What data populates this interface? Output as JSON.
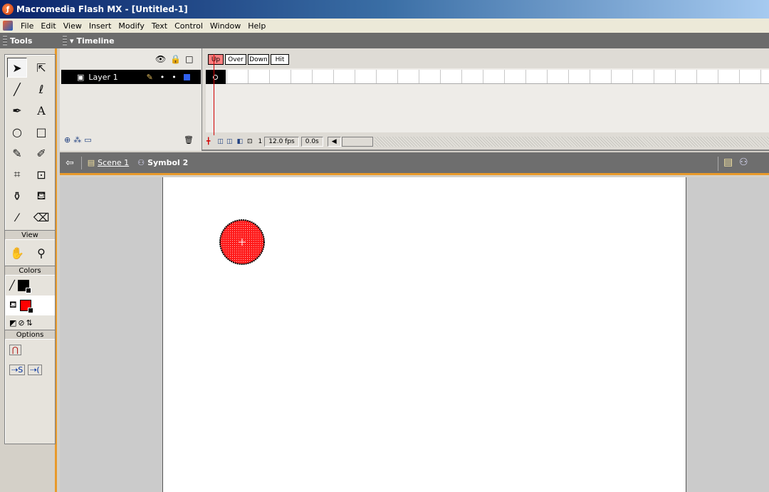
{
  "window": {
    "title": "Macromedia Flash MX - [Untitled-1]"
  },
  "menu": [
    "File",
    "Edit",
    "View",
    "Insert",
    "Modify",
    "Text",
    "Control",
    "Window",
    "Help"
  ],
  "tools_panel": {
    "title": "Tools",
    "tools": [
      "arrow-tool",
      "subselect-tool",
      "line-tool",
      "lasso-tool",
      "pen-tool",
      "text-tool",
      "oval-tool",
      "rectangle-tool",
      "pencil-tool",
      "brush-tool",
      "free-transform-tool",
      "fill-transform-tool",
      "ink-bottle-tool",
      "paint-bucket-tool",
      "eyedropper-tool",
      "eraser-tool"
    ],
    "view_label": "View",
    "colors_label": "Colors",
    "options_label": "Options",
    "stroke_color": "#000000",
    "fill_color": "#ff0000"
  },
  "timeline": {
    "title": "Timeline",
    "states": [
      "Up",
      "Over",
      "Down",
      "Hit"
    ],
    "layer_name": "Layer 1",
    "current_frame": "1",
    "frame_rate": "12.0 fps",
    "elapsed": "0.0s"
  },
  "editbar": {
    "scene": "Scene 1",
    "symbol": "Symbol 2"
  },
  "stage": {
    "shape": "circle",
    "fill": "#ff0000",
    "stroke": "#000000"
  }
}
